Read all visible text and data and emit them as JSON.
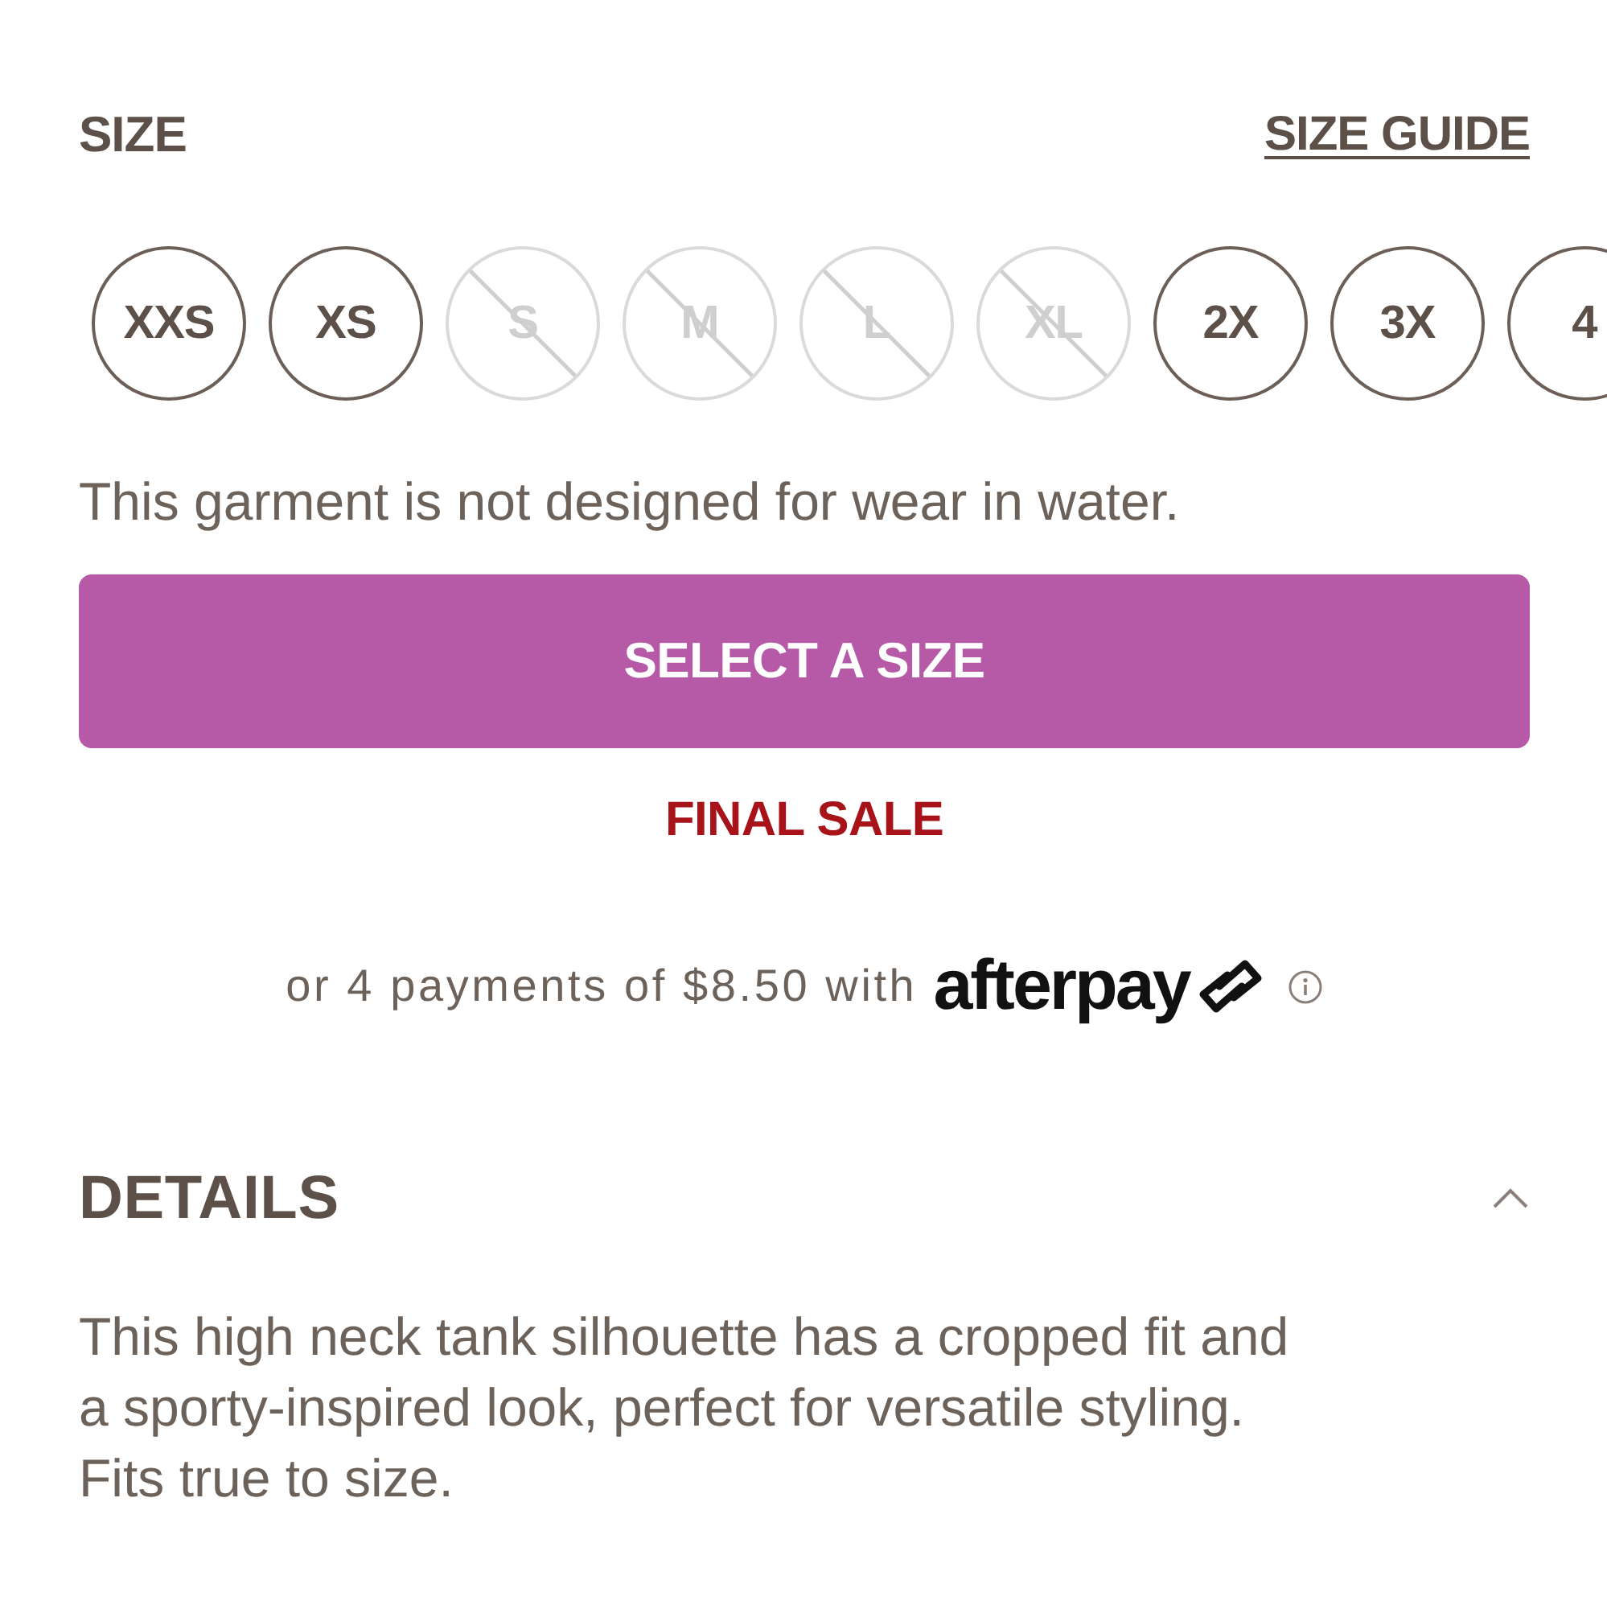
{
  "size_section": {
    "title": "SIZE",
    "guide_link": "SIZE GUIDE"
  },
  "sizes": [
    {
      "label": "XXS",
      "available": true,
      "selected": false
    },
    {
      "label": "XS",
      "available": true,
      "selected": false
    },
    {
      "label": "S",
      "available": false,
      "selected": false
    },
    {
      "label": "M",
      "available": false,
      "selected": false
    },
    {
      "label": "L",
      "available": false,
      "selected": false
    },
    {
      "label": "XL",
      "available": false,
      "selected": false
    },
    {
      "label": "2X",
      "available": true,
      "selected": false
    },
    {
      "label": "3X",
      "available": true,
      "selected": false
    },
    {
      "label": "4",
      "available": true,
      "selected": false
    }
  ],
  "care_note": "This garment is not designed for wear in water.",
  "add_button": {
    "label": "SELECT A SIZE"
  },
  "sale_label": "FINAL SALE",
  "installments": {
    "text": "or 4 payments of $8.50 with",
    "provider": "afterpay"
  },
  "details": {
    "title": "DETAILS",
    "expanded": true,
    "text": "This high neck tank silhouette has a cropped fit and a sporty-inspired look, perfect for versatile styling. Fits true to size."
  }
}
